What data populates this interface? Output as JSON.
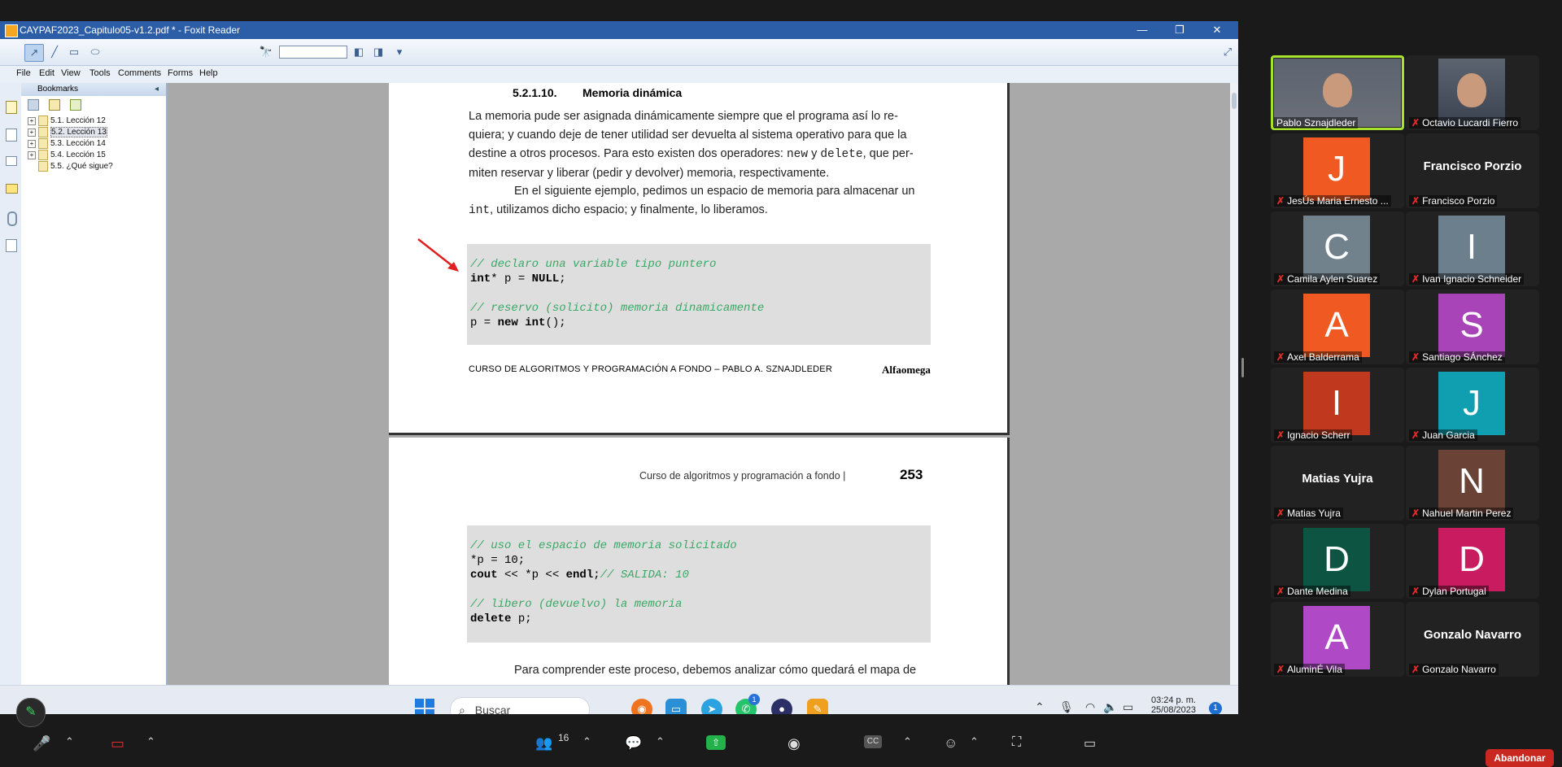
{
  "window": {
    "title": "CAYPAF2023_Capitulo05-v1.2.pdf * - Foxit Reader",
    "minimize": "—",
    "restore": "❐",
    "close": "✕"
  },
  "menu": [
    "File",
    "Edit",
    "View",
    "Tools",
    "Comments",
    "Forms",
    "Help"
  ],
  "bookmarks": {
    "header": "Bookmarks",
    "collapse": "◂",
    "items": [
      "5.1. Lección 12",
      "5.2. Lección 13",
      "5.3. Lección 14",
      "5.4. Lección 15",
      "5.5. ¿Qué sigue?"
    ]
  },
  "page1": {
    "section_number": "5.2.1.10.",
    "section_title": "Memoria dinámica",
    "p1_l1": "La memoria pude ser asignada dinámicamente siempre que el programa así lo re-",
    "p1_l2": "quiera; y cuando deje de tener utilidad ser devuelta al sistema operativo para que la",
    "p1_l3": "destine a otros procesos. Para esto existen dos operadores:",
    "p1_l3_new": "new",
    "p1_l3_y": "y",
    "p1_l3_delete": "delete",
    "p1_l3_tail": ", que per-",
    "p1_l4": "miten reservar y liberar (pedir y devolver) memoria, respectivamente.",
    "p2_l1": "En el siguiente ejemplo, pedimos un espacio de memoria para almacenar un",
    "p2_int": "int",
    "p2_l2": ", utilizamos dicho espacio; y finalmente, lo liberamos.",
    "code_c1": "// declaro una variable tipo puntero",
    "code_kw_int": "int",
    "code_l2": "* p = ",
    "code_null": "NULL",
    "code_semi": ";",
    "code_c2": "// reservo (solicito) memoria dinamicamente",
    "code_l4a": "p = ",
    "code_new": "new",
    "code_l4b": " ",
    "code_int2": "int",
    "code_l4c": "();",
    "footer_left": "CURSO DE ALGORITMOS Y PROGRAMACIÓN A FONDO – PABLO A. SZNAJDLEDER",
    "footer_right": "Alfaomega"
  },
  "page2": {
    "header": "Curso de algoritmos y programación a fondo |",
    "page_number": "253",
    "c1": "// uso el espacio de memoria solicitado",
    "l2": "*p = 10;",
    "cout": "cout",
    "l3a": " << *p << ",
    "endl": "endl",
    "l3b": ";",
    "c3": "// SALIDA: 10",
    "c4": "// libero (devuelvo) la memoria",
    "kw_delete": "delete",
    "l6": " p;",
    "text": "Para comprender este proceso, debemos analizar cómo quedará el mapa de"
  },
  "taskbar": {
    "search_placeholder": "Buscar",
    "time": "03:24 p. m.",
    "date": "25/08/2023",
    "notif_badge": "1",
    "whatsapp_badge": "1"
  },
  "participants": [
    {
      "name": "Pablo Sznajdleder",
      "initial": "",
      "color": "#6b6f78",
      "video": true,
      "active": true,
      "muted": false
    },
    {
      "name": "Octavio Lucardi Fierro",
      "initial": "",
      "color": "#3a4250",
      "video": true,
      "active": false,
      "muted": true
    },
    {
      "name": "JesÚs Maria Ernesto ...",
      "initial": "J",
      "color": "#f05a22",
      "video": false,
      "muted": true
    },
    {
      "name": "Francisco Porzio",
      "initial": "",
      "bigname": "Francisco Porzio",
      "color": "#222",
      "video": false,
      "muted": true
    },
    {
      "name": "Camila Aylen Suarez",
      "initial": "C",
      "color": "#71828d",
      "video": false,
      "muted": true
    },
    {
      "name": "Ivan Ignacio Schneider",
      "initial": "I",
      "color": "#6b7f8c",
      "video": false,
      "muted": true
    },
    {
      "name": "Axel Balderrama",
      "initial": "A",
      "color": "#f05a22",
      "video": false,
      "muted": true
    },
    {
      "name": "Santiago SÁnchez",
      "initial": "S",
      "color": "#a843b8",
      "video": false,
      "muted": true
    },
    {
      "name": "Ignacio Scherr",
      "initial": "I",
      "color": "#c0391e",
      "video": false,
      "muted": true
    },
    {
      "name": "Juan Garcia",
      "initial": "J",
      "color": "#0f9fb0",
      "video": false,
      "muted": true
    },
    {
      "name": "Matias Yujra",
      "initial": "",
      "bigname": "Matias Yujra",
      "color": "#222",
      "video": false,
      "muted": true
    },
    {
      "name": "Nahuel Martin Perez",
      "initial": "N",
      "color": "#6a4236",
      "video": false,
      "muted": true
    },
    {
      "name": "Dante Medina",
      "initial": "D",
      "color": "#0d5443",
      "video": false,
      "muted": true
    },
    {
      "name": "Dylan Portugal",
      "initial": "D",
      "color": "#c91c60",
      "video": false,
      "muted": true
    },
    {
      "name": "AluminÉ Vila",
      "initial": "A",
      "color": "#b049c5",
      "video": false,
      "muted": true
    },
    {
      "name": "Gonzalo Navarro",
      "initial": "",
      "bigname": "Gonzalo Navarro",
      "color": "#222",
      "video": false,
      "muted": true
    }
  ],
  "zoom": {
    "participants_count": "16",
    "leave": "Abandonar"
  }
}
